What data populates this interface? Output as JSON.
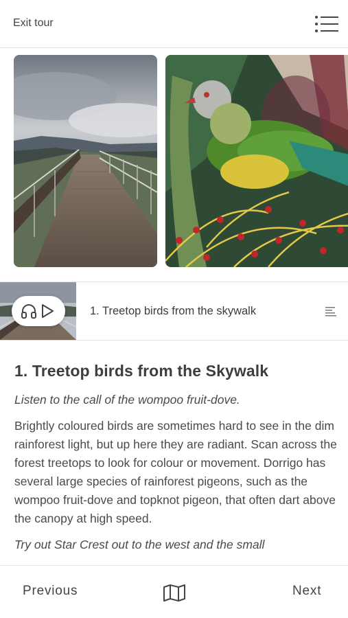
{
  "header": {
    "exit_label": "Exit tour",
    "menu_icon": "hamburger-menu-icon"
  },
  "gallery": {
    "images": [
      {
        "subject": "skywalk-boardwalk-photo"
      },
      {
        "subject": "wompoo-fruit-dove-photo"
      }
    ]
  },
  "audio_player": {
    "headphones_icon": "headphones-icon",
    "play_icon": "play-icon",
    "track_title": "1. Treetop birds from the skywalk",
    "transcript_icon": "transcript-lines-icon"
  },
  "stop": {
    "heading": "1. Treetop birds from the Skywalk",
    "intro": "Listen to the call of the wompoo fruit-dove.",
    "body": "Brightly coloured birds are sometimes hard to see in the dim rainforest light, but up here they are radiant. Scan across the forest treetops to look for colour or movement. Dorrigo has several large species of rainforest pigeons, such as the wompoo fruit-dove and topknot pigeon, that often dart above the canopy at high speed.",
    "body_cut": "Try out Star Crest out to the west and the small"
  },
  "footer": {
    "previous_label": "Previous",
    "map_icon": "map-icon",
    "next_label": "Next"
  },
  "colors": {
    "text": "#3d3d3d",
    "divider": "#e4e4e4"
  }
}
